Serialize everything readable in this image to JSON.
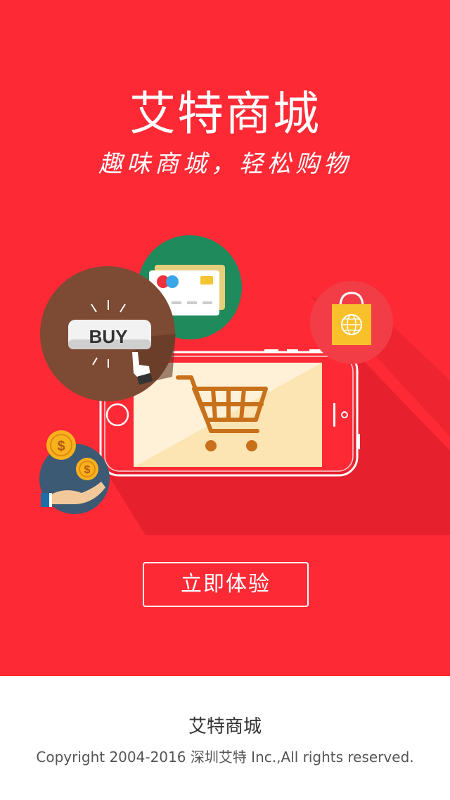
{
  "hero": {
    "title": "艾特商城",
    "slogan": "趣味商城，轻松购物",
    "background_color": "#fd2a36",
    "illustration": {
      "buy_label": "BUY",
      "icons": [
        "credit-card-icon",
        "buy-button-icon",
        "shopping-bag-globe-icon",
        "coin-hand-icon",
        "phone-icon",
        "shopping-cart-icon"
      ]
    },
    "cta_label": "立即体验"
  },
  "footer": {
    "title": "艾特商城",
    "copyright": "Copyright 2004-2016 深圳艾特 Inc.,All rights reserved."
  }
}
